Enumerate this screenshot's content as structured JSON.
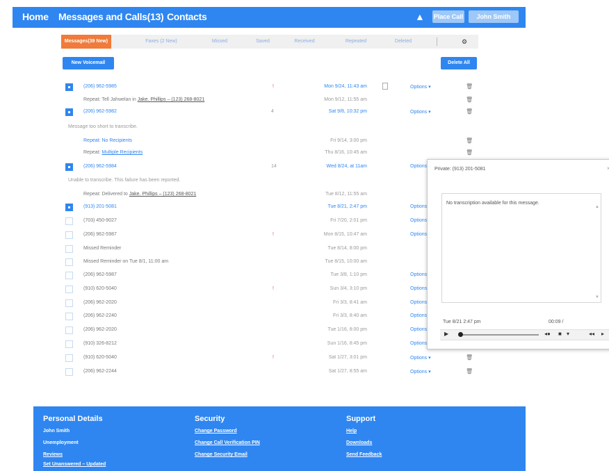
{
  "nav": {
    "home": "Home",
    "messages": "Messages and Calls(13)",
    "contacts": "Contacts",
    "alert_icon": "warning-icon",
    "btn_place_call": "Place Call",
    "btn_user": "John Smith"
  },
  "tabs": [
    {
      "label": "Messages(39 New)"
    },
    {
      "label": "Faxes (2 New)"
    },
    {
      "label": "Missed"
    },
    {
      "label": "Saved"
    },
    {
      "label": "Received"
    },
    {
      "label": "Repeated"
    },
    {
      "label": "Deleted"
    }
  ],
  "tab_gear_icon": "gear-icon",
  "buttons": {
    "new_voicemail": "New Voicemail",
    "delete_all": "Delete All"
  },
  "rows": [
    {
      "checked": true,
      "number": "(206) 962-5985",
      "mark": "!",
      "date": "Mon 9/24, 11:43 am",
      "options": "Options ▾",
      "doc": true
    },
    {
      "sub": "Repeat: Tell Jahwelan in",
      "link": "Jake. Phillips – (123) 268-8021",
      "date": "Mon 9/12, 11:55 am"
    },
    {
      "checked": true,
      "number": "(206) 962-5982",
      "cnt": "4",
      "date": "Sat 9/8, 10:32 pm",
      "options": "Options ▾"
    },
    {
      "info": "Message too short to transcribe."
    },
    {
      "sub": "Repeat: No Recipients",
      "date": "Fri 9/14, 3:00 pm"
    },
    {
      "sub": "Repeat:",
      "linkblue": "Multiple Recipients",
      "date": "Thu 8/16, 10:45 am"
    },
    {
      "checked": true,
      "number": "(206) 962-5984",
      "cnt": "14",
      "date": "Wed 8/24, at 11am",
      "options": "Options"
    },
    {
      "info": "Unable to transcribe. This failure has been reported."
    },
    {
      "sub": "Repeat: Delivered to",
      "link": "Jake. Phillips – (123) 268-8021",
      "date": "Tue 8/12, 11:55 am"
    },
    {
      "checked": true,
      "number": "(913) 201-5081",
      "date": "Tue 8/21, 2:47 pm",
      "options": "Options"
    },
    {
      "number": "(703) 450-9027",
      "date": "Fri 7/20, 2:01 pm",
      "options": "Options"
    },
    {
      "number": "(206) 962-5987",
      "mark": "!",
      "date": "Mon 8/15, 10:47 am",
      "options": "Options"
    },
    {
      "number": "Missed Reminder",
      "date": "Tue 8/14, 8:00 pm"
    },
    {
      "number": "Missed Reminder on Tue 8/1, 11:00 am",
      "date": "Tue 8/15, 10:00 am"
    },
    {
      "number": "(206) 962-5987",
      "date": "Tue 3/8, 1:10 pm",
      "options": "Options"
    },
    {
      "number": "(910) 620-5040",
      "mark": "!",
      "date": "Sun 3/4, 3:10 pm",
      "options": "Options"
    },
    {
      "number": "(206) 962-2020",
      "date": "Fri 3/3, 8:41 am",
      "options": "Options"
    },
    {
      "number": "(206) 962-2240",
      "date": "Fri 3/3, 8:40 am",
      "options": "Options"
    },
    {
      "number": "(206) 962-2020",
      "date": "Tue 1/16, 8:00 pm",
      "options": "Options"
    },
    {
      "number": "(910) 326-8212",
      "date": "Sun 1/16, 8:45 pm",
      "options": "Options"
    },
    {
      "number": "(910) 620-5040",
      "mark": "!",
      "date": "Sat 1/27, 3:01 pm",
      "options": "Options ▾"
    },
    {
      "number": "(206) 962-2244",
      "date": "Sat 1/27, 8:55 am",
      "options": "Options ▾"
    }
  ],
  "popup": {
    "title": "Private: (913) 201-5081",
    "close": "×",
    "transcription": "No transcription available for this message.",
    "date": "Tue 8/21 2:47 pm",
    "duration": "00:09 /"
  },
  "footer": {
    "col1": {
      "heading": "Personal Details",
      "links": [
        "John Smith",
        "Unemployment",
        "Reviews",
        "Set Unanswered – Updated"
      ]
    },
    "col2": {
      "heading": "Security",
      "links": [
        "Change Password",
        "Change Call Verification PIN",
        "Change Security Email"
      ]
    },
    "col3": {
      "heading": "Support",
      "links": [
        "Help",
        "Downloads",
        "Send Feedback"
      ]
    }
  },
  "colors": {
    "brand_blue": "#2f86f0",
    "active_tab": "#f07b3a",
    "alert_red": "#e94a3a"
  }
}
